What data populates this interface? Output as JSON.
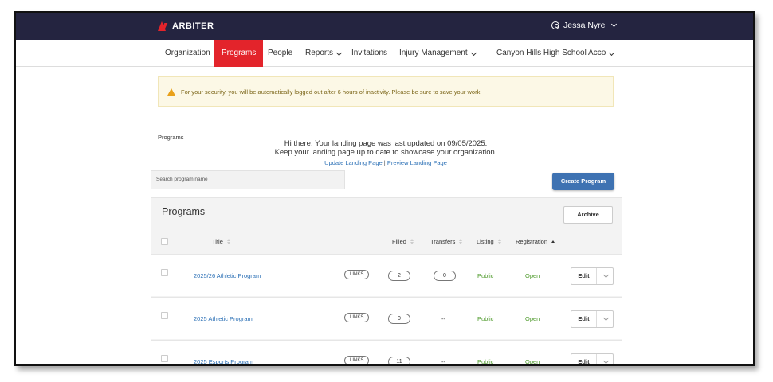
{
  "brand": {
    "name": "ARBITER"
  },
  "user": {
    "name": "Jessa Nyre"
  },
  "nav": {
    "items": [
      {
        "label": "Organization"
      },
      {
        "label": "Programs"
      },
      {
        "label": "People"
      },
      {
        "label": "Reports"
      },
      {
        "label": "Invitations"
      },
      {
        "label": "Injury Management"
      },
      {
        "label": "Canyon Hills High School Acco"
      }
    ]
  },
  "alert": {
    "text": "For your security, you will be automatically logged out after 6 hours of inactivity. Please be sure to save your work."
  },
  "breadcrumb": "Programs",
  "landing": {
    "line1": "Hi there. Your landing page was last updated on 09/05/2025.",
    "line2": "Keep your landing page up to date to showcase your organization.",
    "update_link": "Update Landing Page",
    "separator": "|",
    "preview_link": "Preview Landing Page"
  },
  "search": {
    "placeholder": "Search program name"
  },
  "create_button": "Create Program",
  "programs": {
    "title": "Programs",
    "archive_button": "Archive",
    "columns": {
      "title": "Title",
      "filled": "Filled",
      "transfers": "Transfers",
      "listing": "Listing",
      "registration": "Registration"
    },
    "rows": [
      {
        "title": "2025/26 Athletic Program",
        "links": "LINKS",
        "filled": "2",
        "transfers": "0",
        "listing": "Public",
        "registration": "Open",
        "edit": "Edit"
      },
      {
        "title": "2025 Athletic Program",
        "links": "LINKS",
        "filled": "0",
        "transfers": "--",
        "listing": "Public",
        "registration": "Open",
        "edit": "Edit"
      },
      {
        "title": "2025 Esports Program",
        "links": "LINKS",
        "filled": "11",
        "transfers": "--",
        "listing": "Public",
        "registration": "Open",
        "edit": "Edit"
      }
    ]
  },
  "colors": {
    "topbar": "#242440",
    "accent": "#e3242b",
    "primary_button": "#3e72b2",
    "link": "#2a6fb5",
    "status_green": "#4d9a2a"
  }
}
